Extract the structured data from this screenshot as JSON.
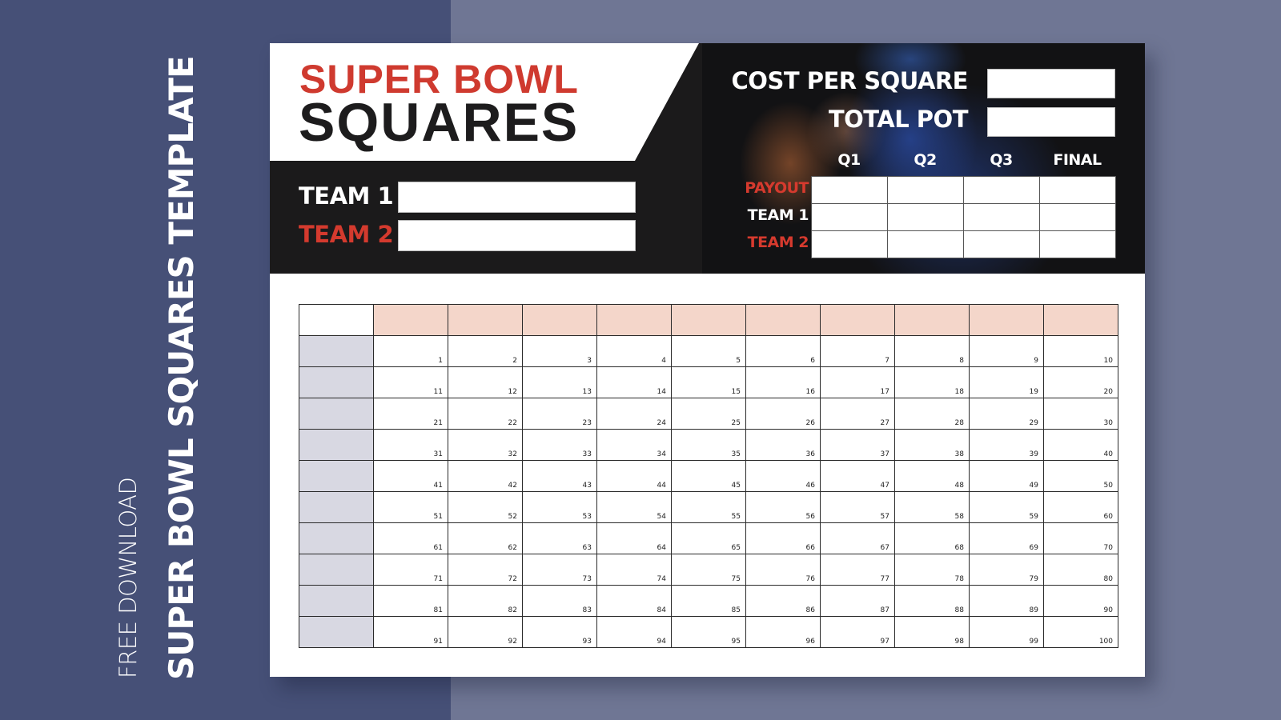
{
  "side_banner": {
    "subtitle": "FREE DOWNLOAD",
    "title": "SUPER BOWL SQUARES TEMPLATE"
  },
  "header": {
    "title_line1": "SUPER BOWL",
    "title_line2": "SQUARES",
    "team1_label": "TEAM 1",
    "team2_label": "TEAM 2",
    "team1_value": "",
    "team2_value": "",
    "cost_label": "COST PER SQUARE",
    "cost_value": "",
    "pot_label": "TOTAL POT",
    "pot_value": ""
  },
  "payout": {
    "columns": [
      "Q1",
      "Q2",
      "Q3",
      "FINAL"
    ],
    "rows": [
      {
        "label": "PAYOUT",
        "values": [
          "",
          "",
          "",
          ""
        ]
      },
      {
        "label": "TEAM 1",
        "values": [
          "",
          "",
          "",
          ""
        ]
      },
      {
        "label": "TEAM 2",
        "values": [
          "",
          "",
          "",
          ""
        ]
      }
    ]
  },
  "grid": {
    "column_digits": [
      "",
      "",
      "",
      "",
      "",
      "",
      "",
      "",
      "",
      ""
    ],
    "row_digits": [
      "",
      "",
      "",
      "",
      "",
      "",
      "",
      "",
      "",
      ""
    ],
    "cells": [
      [
        "1",
        "2",
        "3",
        "4",
        "5",
        "6",
        "7",
        "8",
        "9",
        "10"
      ],
      [
        "11",
        "12",
        "13",
        "14",
        "15",
        "16",
        "17",
        "18",
        "19",
        "20"
      ],
      [
        "21",
        "22",
        "23",
        "24",
        "25",
        "26",
        "27",
        "28",
        "29",
        "30"
      ],
      [
        "31",
        "32",
        "33",
        "34",
        "35",
        "36",
        "37",
        "38",
        "39",
        "40"
      ],
      [
        "41",
        "42",
        "43",
        "44",
        "45",
        "46",
        "47",
        "48",
        "49",
        "50"
      ],
      [
        "51",
        "52",
        "53",
        "54",
        "55",
        "56",
        "57",
        "58",
        "59",
        "60"
      ],
      [
        "61",
        "62",
        "63",
        "64",
        "65",
        "66",
        "67",
        "68",
        "69",
        "70"
      ],
      [
        "71",
        "72",
        "73",
        "74",
        "75",
        "76",
        "77",
        "78",
        "79",
        "80"
      ],
      [
        "81",
        "82",
        "83",
        "84",
        "85",
        "86",
        "87",
        "88",
        "89",
        "90"
      ],
      [
        "91",
        "92",
        "93",
        "94",
        "95",
        "96",
        "97",
        "98",
        "99",
        "100"
      ]
    ]
  },
  "colors": {
    "accent_red": "#cf3a2f",
    "banner_bg": "#465077",
    "page_bg": "#6f7694",
    "column_header_fill": "#f4d6ca",
    "row_header_fill": "#d8d8e2"
  }
}
